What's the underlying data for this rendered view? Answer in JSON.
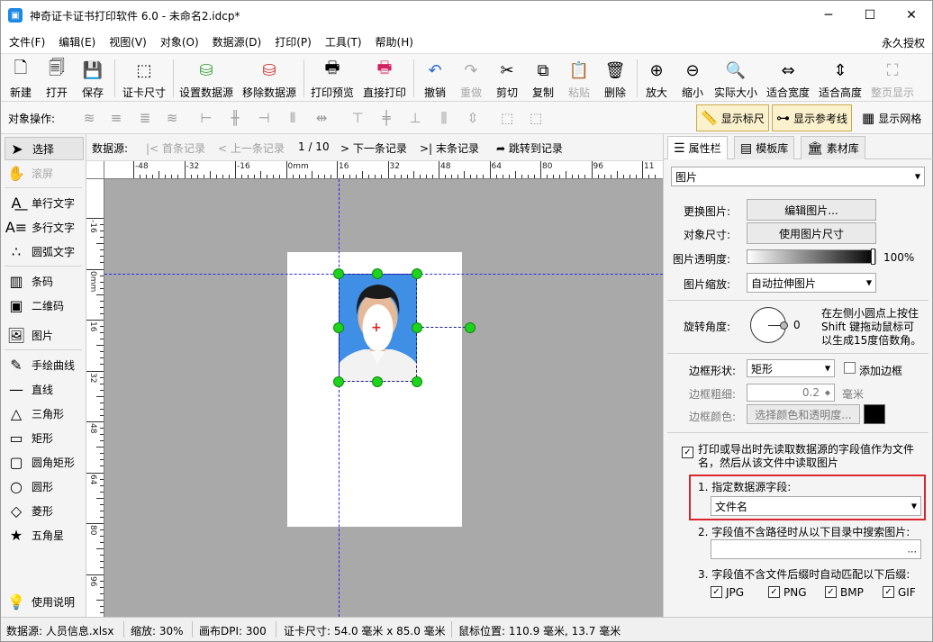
{
  "window": {
    "title": "神奇证卡证书打印软件 6.0 - 未命名2.idcp*",
    "minimize": "─",
    "maximize": "☐",
    "close": "✕"
  },
  "menu": {
    "items": [
      "文件(F)",
      "编辑(E)",
      "视图(V)",
      "对象(O)",
      "数据源(D)",
      "打印(P)",
      "工具(T)",
      "帮助(H)"
    ],
    "right": "永久授权"
  },
  "toolbar": {
    "new": "新建",
    "open": "打开",
    "save": "保存",
    "card_size": "证卡尺寸",
    "set_datasource": "设置数据源",
    "remove_datasource": "移除数据源",
    "print_preview": "打印预览",
    "direct_print": "直接打印",
    "undo": "撤销",
    "redo": "重做",
    "cut": "剪切",
    "copy": "复制",
    "paste": "粘贴",
    "delete": "删除",
    "zoom_in": "放大",
    "zoom_out": "缩小",
    "actual_size": "实际大小",
    "fit_width": "适合宽度",
    "fit_height": "适合高度",
    "full_page": "整页显示"
  },
  "objbar": {
    "label": "对象操作:",
    "show_ruler": "显示标尺",
    "show_guides": "显示参考线",
    "show_grid": "显示网格"
  },
  "left_tools": {
    "select": "选择",
    "scroll": "滚屏",
    "single_text": "单行文字",
    "multi_text": "多行文字",
    "arc_text": "圆弧文字",
    "barcode": "条码",
    "qrcode": "二维码",
    "image": "图片",
    "freehand": "手绘曲线",
    "line": "直线",
    "triangle": "三角形",
    "rectangle": "矩形",
    "round_rect": "圆角矩形",
    "circle": "圆形",
    "diamond": "菱形",
    "star": "五角星",
    "help": "使用说明"
  },
  "datasource_bar": {
    "label": "数据源:",
    "first": "首条记录",
    "prev": "上一条记录",
    "position": "1 / 10",
    "next": "下一条记录",
    "last": "末条记录",
    "jump": "跳转到记录"
  },
  "ruler": {
    "h_labels": [
      "-48",
      "-32",
      "-16",
      "0mm",
      "16",
      "32",
      "48",
      "64",
      "80",
      "96",
      "11"
    ],
    "v_labels": [
      "-16",
      "0mm",
      "16",
      "32",
      "48",
      "64",
      "80",
      "96"
    ]
  },
  "right_panel": {
    "tabs": [
      "属性栏",
      "模板库",
      "素材库"
    ],
    "object_type": "图片",
    "change_image_label": "更换图片:",
    "edit_image_btn": "编辑图片...",
    "object_size_label": "对象尺寸:",
    "use_image_size_btn": "使用图片尺寸",
    "opacity_label": "图片透明度:",
    "opacity_value": "100%",
    "opacity": 1.0,
    "scale_label": "图片缩放:",
    "scale_value": "自动拉伸图片",
    "rotation_label": "旋转角度:",
    "rotation_value": "0",
    "rotation_hint_1": "在左侧小圆点上按住",
    "rotation_hint_2": "Shift 键拖动鼠标可",
    "rotation_hint_3": "以生成15度倍数角。",
    "border_shape_label": "边框形状:",
    "border_shape_value": "矩形",
    "add_border": "添加边框",
    "border_width_label": "边框粗细:",
    "border_width_value": "0.2",
    "border_width_unit": "毫米",
    "border_color_label": "边框颜色:",
    "border_color_btn": "选择颜色和透明度...",
    "read_from_field_1": "打印或导出时先读取数据源的字段值作为文件",
    "read_from_field_2": "名，然后从该文件中读取图片",
    "field_label": "1. 指定数据源字段:",
    "field_value": "文件名",
    "search_dir_label": "2. 字段值不含路径时从以下目录中搜索图片:",
    "search_dir_value": "",
    "browse": "...",
    "ext_label": "3. 字段值不含文件后缀时自动匹配以下后缀:",
    "ext": [
      "JPG",
      "PNG",
      "BMP",
      "GIF"
    ],
    "check": "✓",
    "colors": {
      "border_swatch": "#000000",
      "highlight": "#d9262c"
    }
  },
  "status": {
    "datasource": "数据源: 人员信息.xlsx",
    "zoom": "缩放: 30%",
    "dpi": "画布DPI: 300",
    "card_size": "证卡尺寸: 54.0 毫米 x 85.0 毫米",
    "mouse": "鼠标位置: 110.9 毫米, 13.7 毫米"
  }
}
